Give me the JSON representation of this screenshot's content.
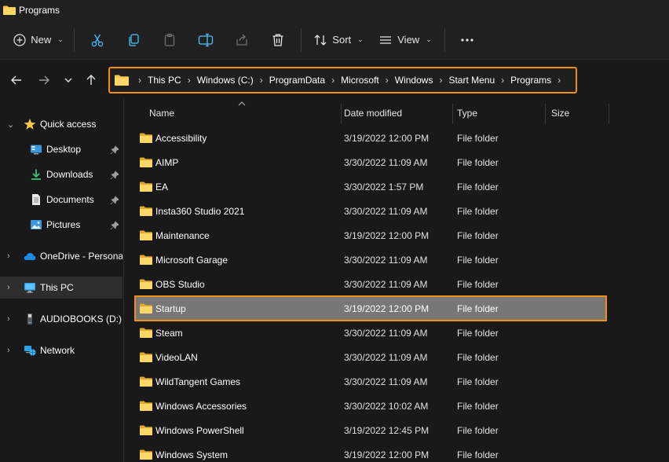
{
  "window": {
    "title": "Programs",
    "icon": "folder-icon"
  },
  "toolbar": {
    "new_label": "New",
    "cut_icon": "scissors-icon",
    "copy_icon": "copy-icon",
    "paste_icon": "clipboard-icon",
    "rename_icon": "rename-icon",
    "share_icon": "share-icon",
    "delete_icon": "trash-icon",
    "sort_label": "Sort",
    "view_label": "View",
    "more_icon": "ellipsis-icon"
  },
  "address": {
    "crumbs": [
      "This PC",
      "Windows (C:)",
      "ProgramData",
      "Microsoft",
      "Windows",
      "Start Menu",
      "Programs"
    ]
  },
  "sidebar": {
    "items": [
      {
        "label": "Quick access",
        "icon": "star-icon"
      },
      {
        "label": "Desktop",
        "icon": "desktop-icon",
        "pinned": true
      },
      {
        "label": "Downloads",
        "icon": "download-icon",
        "pinned": true
      },
      {
        "label": "Documents",
        "icon": "document-icon",
        "pinned": true
      },
      {
        "label": "Pictures",
        "icon": "pictures-icon",
        "pinned": true
      },
      {
        "label": "OneDrive - Personal",
        "icon": "cloud-icon"
      },
      {
        "label": "This PC",
        "icon": "monitor-icon"
      },
      {
        "label": "AUDIOBOOKS (D:)",
        "icon": "drive-icon"
      },
      {
        "label": "Network",
        "icon": "network-icon"
      }
    ]
  },
  "list": {
    "columns": [
      "Name",
      "Date modified",
      "Type",
      "Size"
    ],
    "rows": [
      {
        "name": "Accessibility",
        "date": "3/19/2022 12:00 PM",
        "type": "File folder"
      },
      {
        "name": "AIMP",
        "date": "3/30/2022 11:09 AM",
        "type": "File folder"
      },
      {
        "name": "EA",
        "date": "3/30/2022 1:57 PM",
        "type": "File folder"
      },
      {
        "name": "Insta360 Studio 2021",
        "date": "3/30/2022 11:09 AM",
        "type": "File folder"
      },
      {
        "name": "Maintenance",
        "date": "3/19/2022 12:00 PM",
        "type": "File folder"
      },
      {
        "name": "Microsoft Garage",
        "date": "3/30/2022 11:09 AM",
        "type": "File folder"
      },
      {
        "name": "OBS Studio",
        "date": "3/30/2022 11:09 AM",
        "type": "File folder"
      },
      {
        "name": "Startup",
        "date": "3/19/2022 12:00 PM",
        "type": "File folder"
      },
      {
        "name": "Steam",
        "date": "3/30/2022 11:09 AM",
        "type": "File folder"
      },
      {
        "name": "VideoLAN",
        "date": "3/30/2022 11:09 AM",
        "type": "File folder"
      },
      {
        "name": "WildTangent Games",
        "date": "3/30/2022 11:09 AM",
        "type": "File folder"
      },
      {
        "name": "Windows Accessories",
        "date": "3/30/2022 10:02 AM",
        "type": "File folder"
      },
      {
        "name": "Windows PowerShell",
        "date": "3/19/2022 12:45 PM",
        "type": "File folder"
      },
      {
        "name": "Windows System",
        "date": "3/19/2022 12:00 PM",
        "type": "File folder"
      }
    ],
    "selected": "Startup"
  },
  "colors": {
    "highlight": "#f0900f",
    "folder": "#f8c84a",
    "accent": "#4cc2ff",
    "selected_row": "#777777",
    "background": "#191919"
  }
}
